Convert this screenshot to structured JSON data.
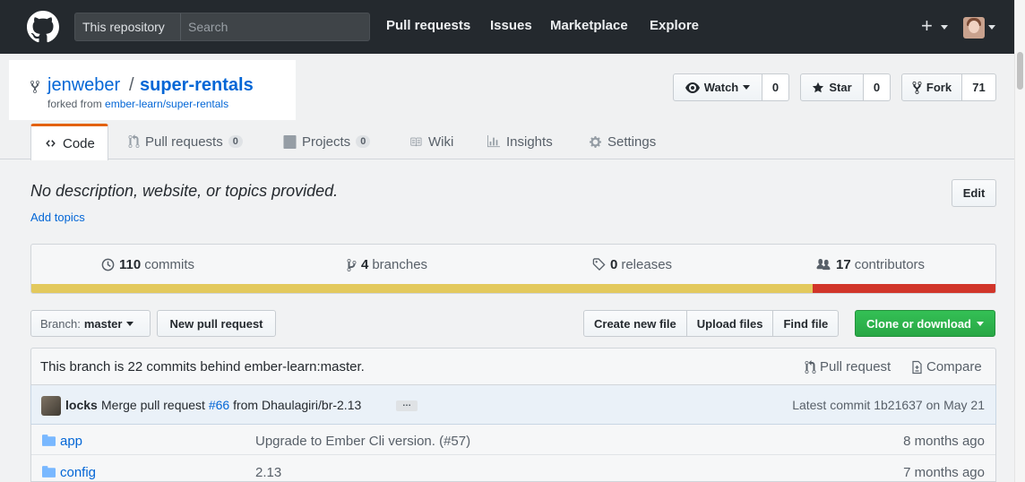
{
  "header": {
    "search_scope": "This repository",
    "search_placeholder": "Search",
    "nav": [
      "Pull requests",
      "Issues",
      "Marketplace",
      "Explore"
    ],
    "plus_label": "+"
  },
  "repo": {
    "owner": "jenweber",
    "separator": "/",
    "name": "super-rentals",
    "forked_prefix": "forked from",
    "forked_from": "ember-learn/super-rentals",
    "watch_label": "Watch",
    "watch_count": "0",
    "star_label": "Star",
    "star_count": "0",
    "fork_label": "Fork",
    "fork_count": "71"
  },
  "tabs": [
    {
      "label": "Code",
      "icon": "code-icon"
    },
    {
      "label": "Pull requests",
      "icon": "pull-request-icon",
      "count": "0"
    },
    {
      "label": "Projects",
      "icon": "project-icon",
      "count": "0"
    },
    {
      "label": "Wiki",
      "icon": "book-icon"
    },
    {
      "label": "Insights",
      "icon": "graph-icon"
    },
    {
      "label": "Settings",
      "icon": "gear-icon"
    }
  ],
  "about": {
    "description": "No description, website, or topics provided.",
    "add_topics": "Add topics",
    "edit_label": "Edit"
  },
  "summary": {
    "commits_count": "110",
    "commits_label": "commits",
    "branches_count": "4",
    "branches_label": "branches",
    "releases_count": "0",
    "releases_label": "releases",
    "contributors_count": "17",
    "contributors_label": "contributors",
    "language_colors": [
      "#e3c95d",
      "#d1352a"
    ],
    "language_shares": [
      0.81,
      0.19
    ]
  },
  "file_nav": {
    "branch_prefix": "Branch:",
    "branch_name": "master",
    "new_pr": "New pull request",
    "create_file": "Create new file",
    "upload_files": "Upload files",
    "find_file": "Find file",
    "clone": "Clone or download"
  },
  "branch_status": {
    "text": "This branch is 22 commits behind ember-learn:master.",
    "pull_request": "Pull request",
    "compare": "Compare"
  },
  "latest_commit": {
    "author": "locks",
    "message_prefix": "Merge pull request",
    "pr_link": "#66",
    "message_suffix": "from Dhaulagiri/br-2.13",
    "ellipsis": "…",
    "latest_label": "Latest commit",
    "sha": "1b21637",
    "date": "on May 21"
  },
  "files": [
    {
      "name": "app",
      "message": "Upgrade to Ember Cli version. (#57)",
      "age": "8 months ago"
    },
    {
      "name": "config",
      "message": "2.13",
      "age": "7 months ago"
    }
  ]
}
